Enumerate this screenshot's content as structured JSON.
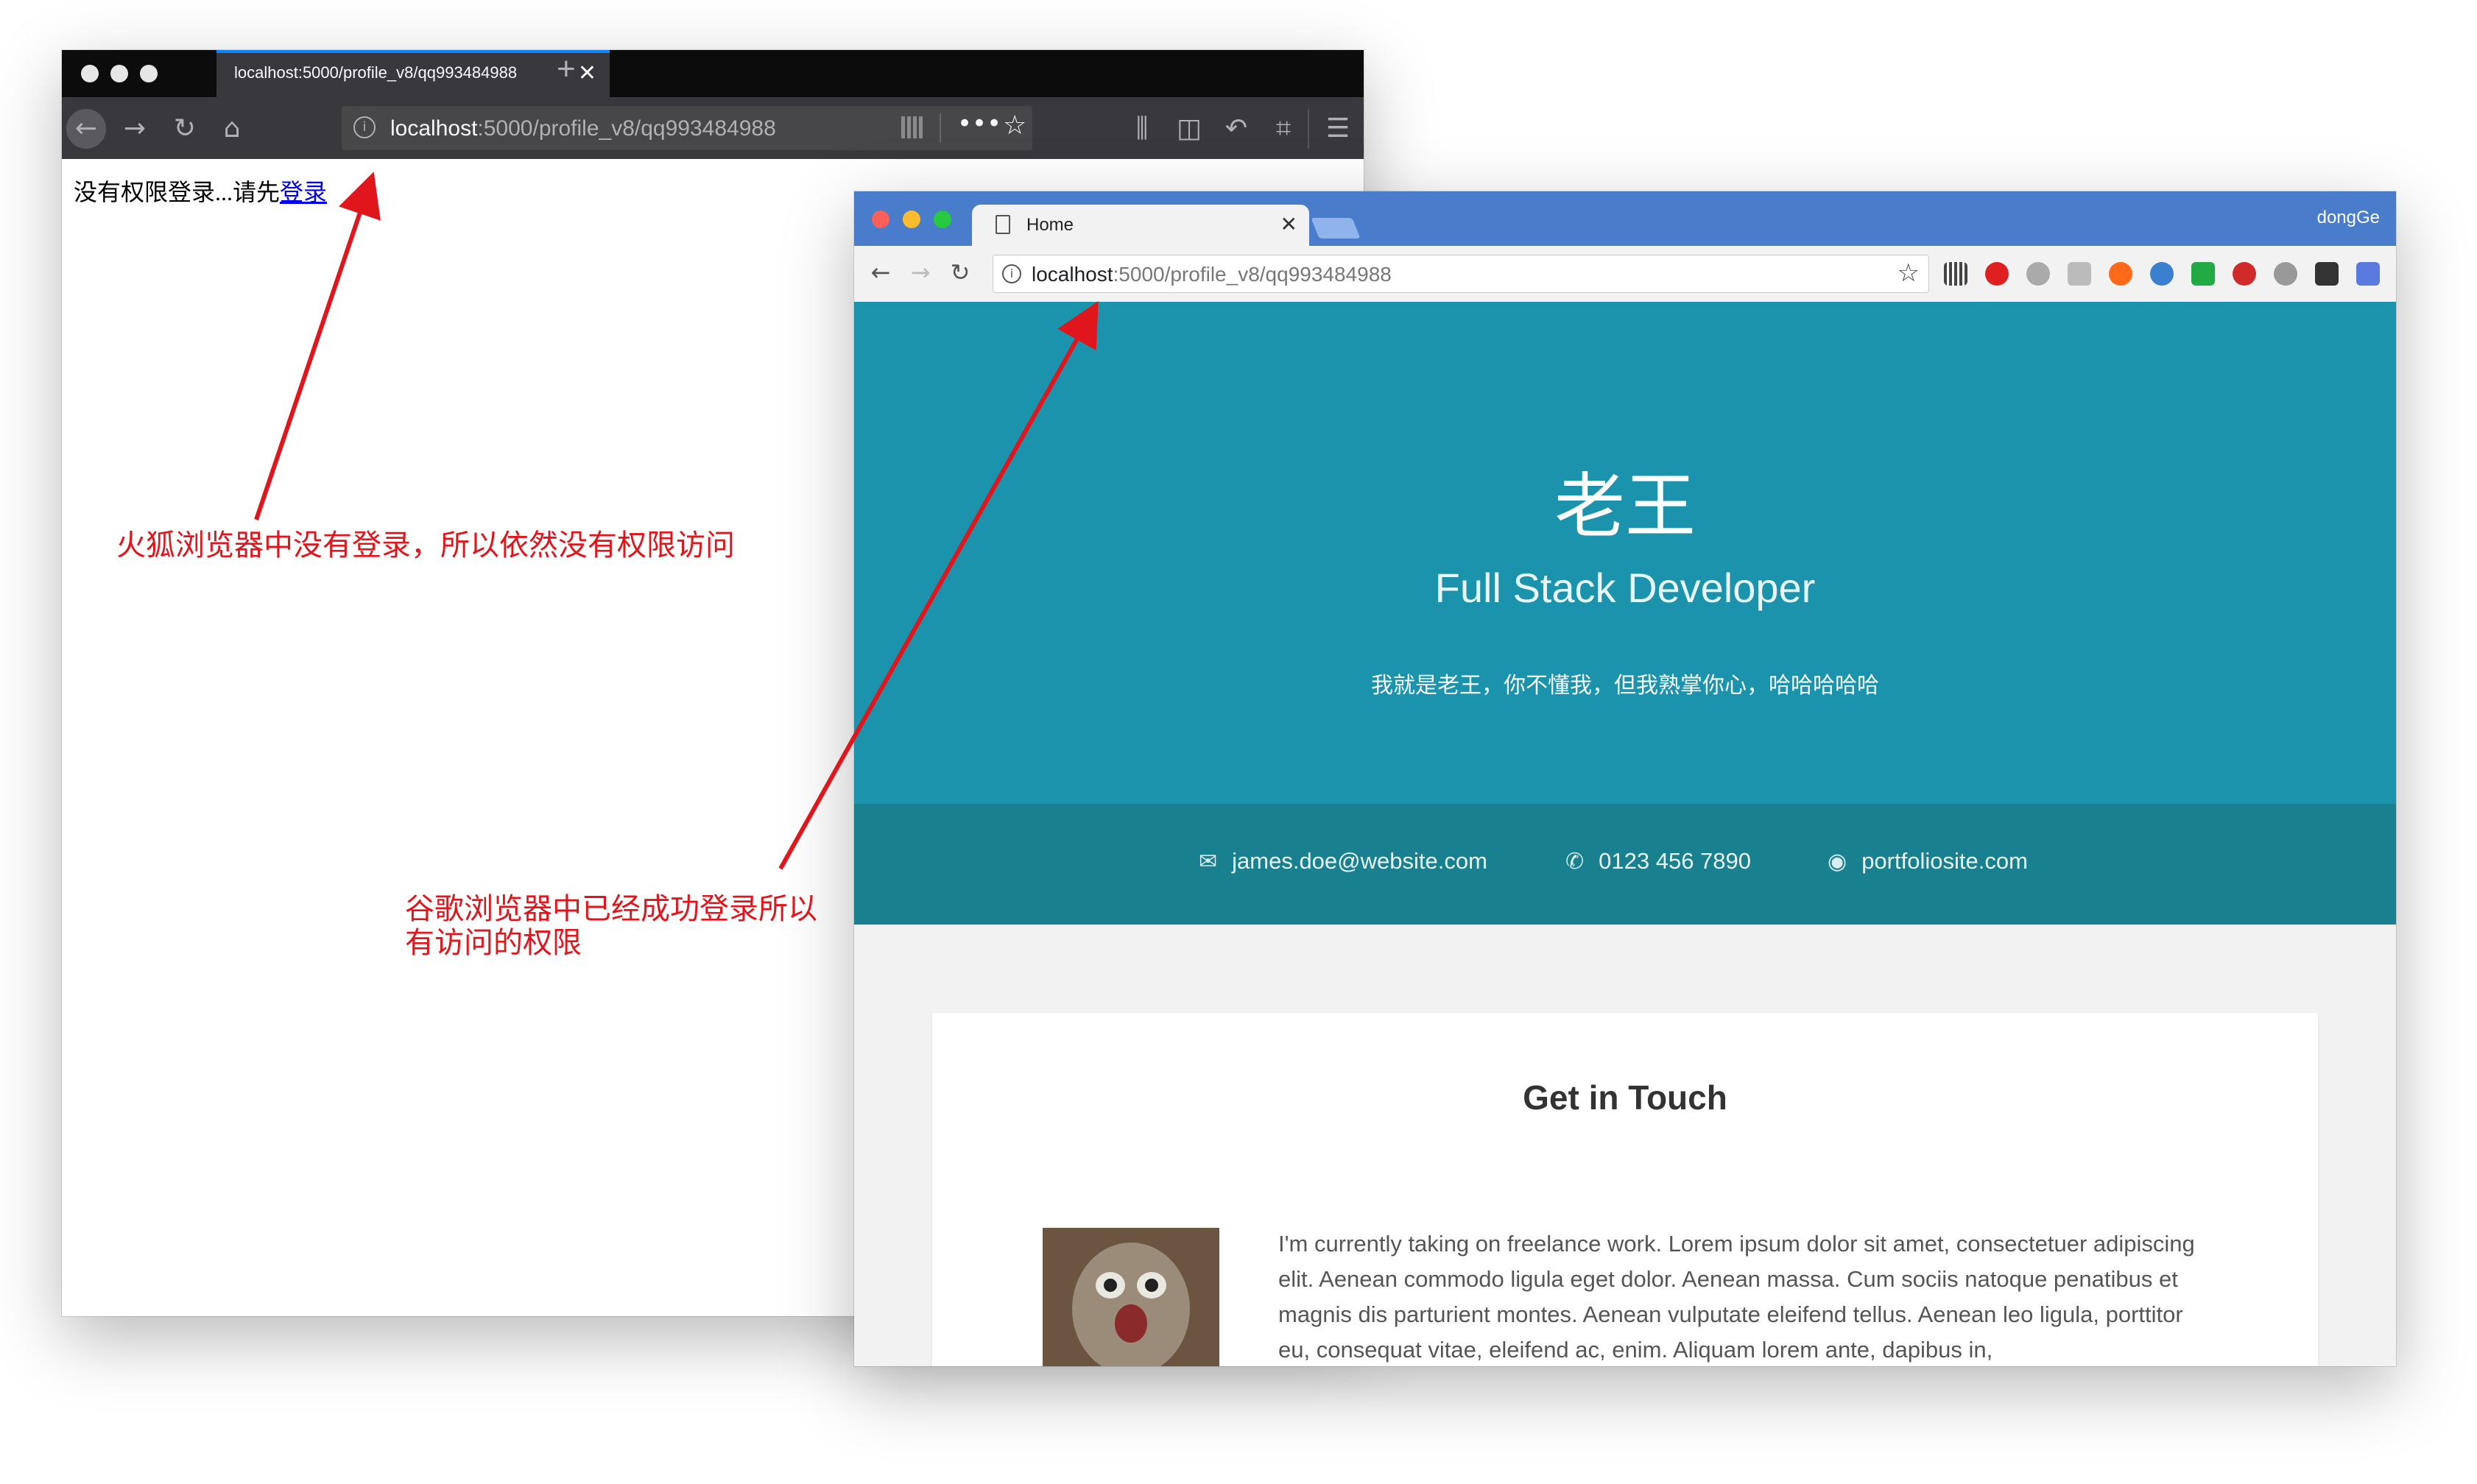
{
  "firefox": {
    "tab_title": "localhost:5000/profile_v8/qq993484988",
    "tab_close_icon": "close-icon",
    "new_tab_label": "+",
    "url_host": "localhost",
    "url_path": ":5000/profile_v8/qq993484988",
    "page_text": "没有权限登录...请先",
    "login_link": "登录"
  },
  "chrome": {
    "tab_title": "Home",
    "profile_name": "dongGe",
    "url_host": "localhost",
    "url_path": ":5000/profile_v8/qq993484988",
    "hero": {
      "name": "老王",
      "role": "Full Stack Developer",
      "bio": "我就是老王，你不懂我，但我熟掌你心，哈哈哈哈哈"
    },
    "contact": {
      "email": "james.doe@website.com",
      "phone": "0123 456 7890",
      "website": "portfoliosite.com"
    },
    "section": {
      "title": "Get in Touch",
      "text": "I'm currently taking on freelance work. Lorem ipsum dolor sit amet, consectetuer adipiscing elit. Aenean commodo ligula eget dolor. Aenean massa. Cum sociis natoque penatibus et magnis dis parturient montes. Aenean vulputate eleifend tellus. Aenean leo ligula, porttitor eu, consequat vitae, eleifend ac, enim. Aliquam lorem ante, dapibus in,"
    },
    "colors": {
      "hero_bg": "#1c93ac",
      "contact_bg": "#18808e",
      "titlebar": "#4a7ccc"
    }
  },
  "annotations": {
    "firefox_note": "火狐浏览器中没有登录，所以依然没有权限访问",
    "chrome_note_line1": "谷歌浏览器中已经成功登录所以",
    "chrome_note_line2": "有访问的权限",
    "arrow_color": "#e0161c"
  }
}
